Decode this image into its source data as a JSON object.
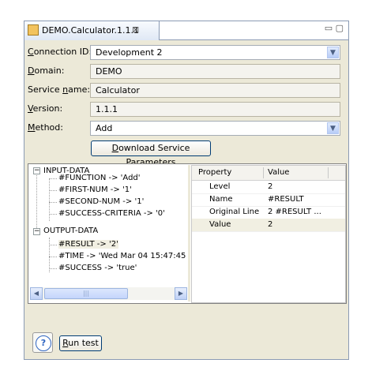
{
  "tab": {
    "title": "DEMO.Calculator.1.1.1",
    "close_glyph": "⊠",
    "window_controls": "▭ ▢"
  },
  "form": {
    "connection_label_u": "C",
    "connection_label_rest": "onnection ID:",
    "connection_value": "Development 2",
    "domain_label_u": "D",
    "domain_label_rest": "omain:",
    "domain_value": "DEMO",
    "service_label_pre": "Service ",
    "service_label_u": "n",
    "service_label_rest": "ame:",
    "service_value": "Calculator",
    "version_label_u": "V",
    "version_label_rest": "ersion:",
    "version_value": "1.1.1",
    "method_label_u": "M",
    "method_label_rest": "ethod:",
    "method_value": "Add",
    "download_u": "D",
    "download_rest": "ownload Service Parameters"
  },
  "tree": {
    "input": "INPUT-DATA",
    "input_children": [
      "#FUNCTION -> 'Add'",
      "#FIRST-NUM -> '1'",
      "#SECOND-NUM -> '1'",
      "#SUCCESS-CRITERIA -> '0'"
    ],
    "output": "OUTPUT-DATA",
    "output_children": [
      "#RESULT -> '2'",
      "#TIME -> 'Wed Mar 04 15:47:45",
      "#SUCCESS -> 'true'"
    ]
  },
  "props": {
    "col_property": "Property",
    "col_value": "Value",
    "rows": [
      {
        "key": "Level",
        "value": "2"
      },
      {
        "key": "Name",
        "value": "#RESULT"
      },
      {
        "key": "Original Line",
        "value": "2 #RESULT ..."
      },
      {
        "key": "Value",
        "value": "2"
      }
    ]
  },
  "footer": {
    "help_glyph": "?",
    "run_u": "R",
    "run_rest": "un test"
  }
}
